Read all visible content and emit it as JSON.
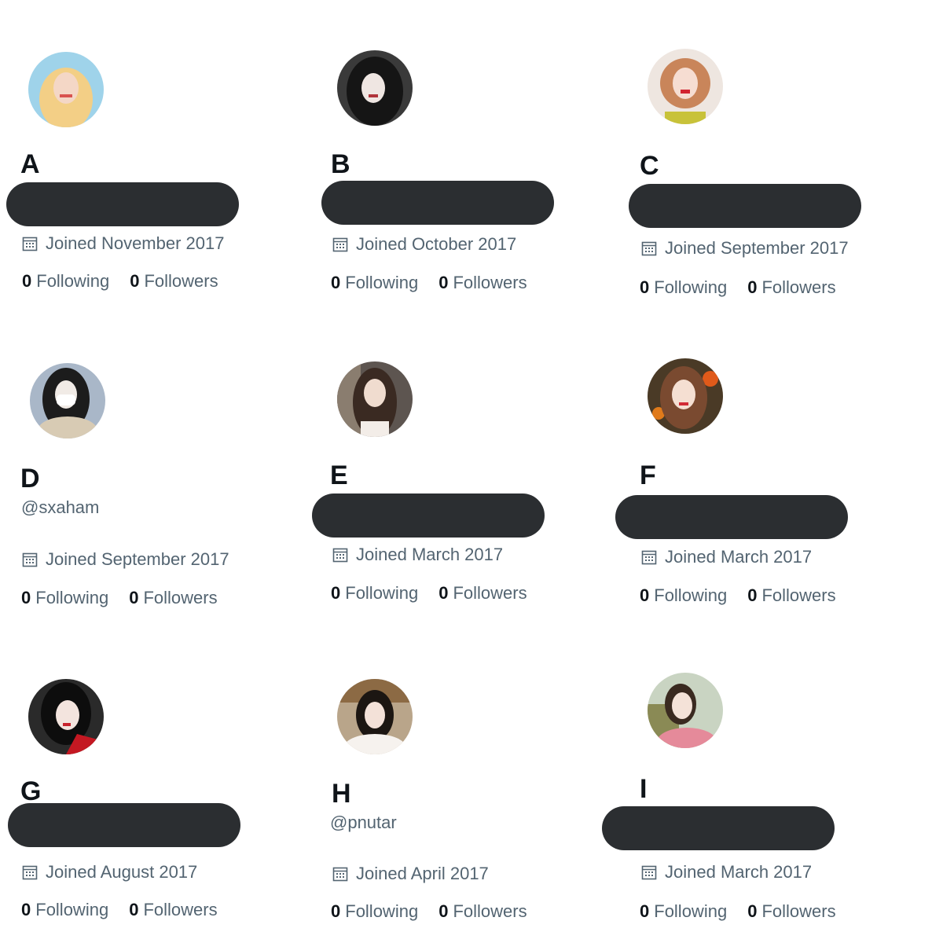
{
  "profiles": [
    {
      "letter": "A",
      "handle": "",
      "joined": "Joined November 2017",
      "following_count": "0",
      "following_label": "Following",
      "followers_count": "0",
      "followers_label": "Followers"
    },
    {
      "letter": "B",
      "handle": "",
      "joined": "Joined October 2017",
      "following_count": "0",
      "following_label": "Following",
      "followers_count": "0",
      "followers_label": "Followers"
    },
    {
      "letter": "C",
      "handle": "",
      "joined": "Joined September 2017",
      "following_count": "0",
      "following_label": "Following",
      "followers_count": "0",
      "followers_label": "Followers"
    },
    {
      "letter": "D",
      "handle": "@sxaham",
      "joined": "Joined September 2017",
      "following_count": "0",
      "following_label": "Following",
      "followers_count": "0",
      "followers_label": "Followers"
    },
    {
      "letter": "E",
      "handle": "",
      "joined": "Joined March 2017",
      "following_count": "0",
      "following_label": "Following",
      "followers_count": "0",
      "followers_label": "Followers"
    },
    {
      "letter": "F",
      "handle": "",
      "joined": "Joined March 2017",
      "following_count": "0",
      "following_label": "Following",
      "followers_count": "0",
      "followers_label": "Followers"
    },
    {
      "letter": "G",
      "handle": "",
      "joined": "Joined August 2017",
      "following_count": "0",
      "following_label": "Following",
      "followers_count": "0",
      "followers_label": "Followers"
    },
    {
      "letter": "H",
      "handle": "@pnutar",
      "joined": "Joined April 2017",
      "following_count": "0",
      "following_label": "Following",
      "followers_count": "0",
      "followers_label": "Followers"
    },
    {
      "letter": "I",
      "handle": "",
      "joined": "Joined March 2017",
      "following_count": "0",
      "following_label": "Following",
      "followers_count": "0",
      "followers_label": "Followers"
    }
  ],
  "icons": {
    "joined": "calendar-icon",
    "avatar": "profile-photo"
  },
  "colors": {
    "text_primary": "#0f1419",
    "text_secondary": "#536471",
    "redaction": "#2b2e31"
  }
}
